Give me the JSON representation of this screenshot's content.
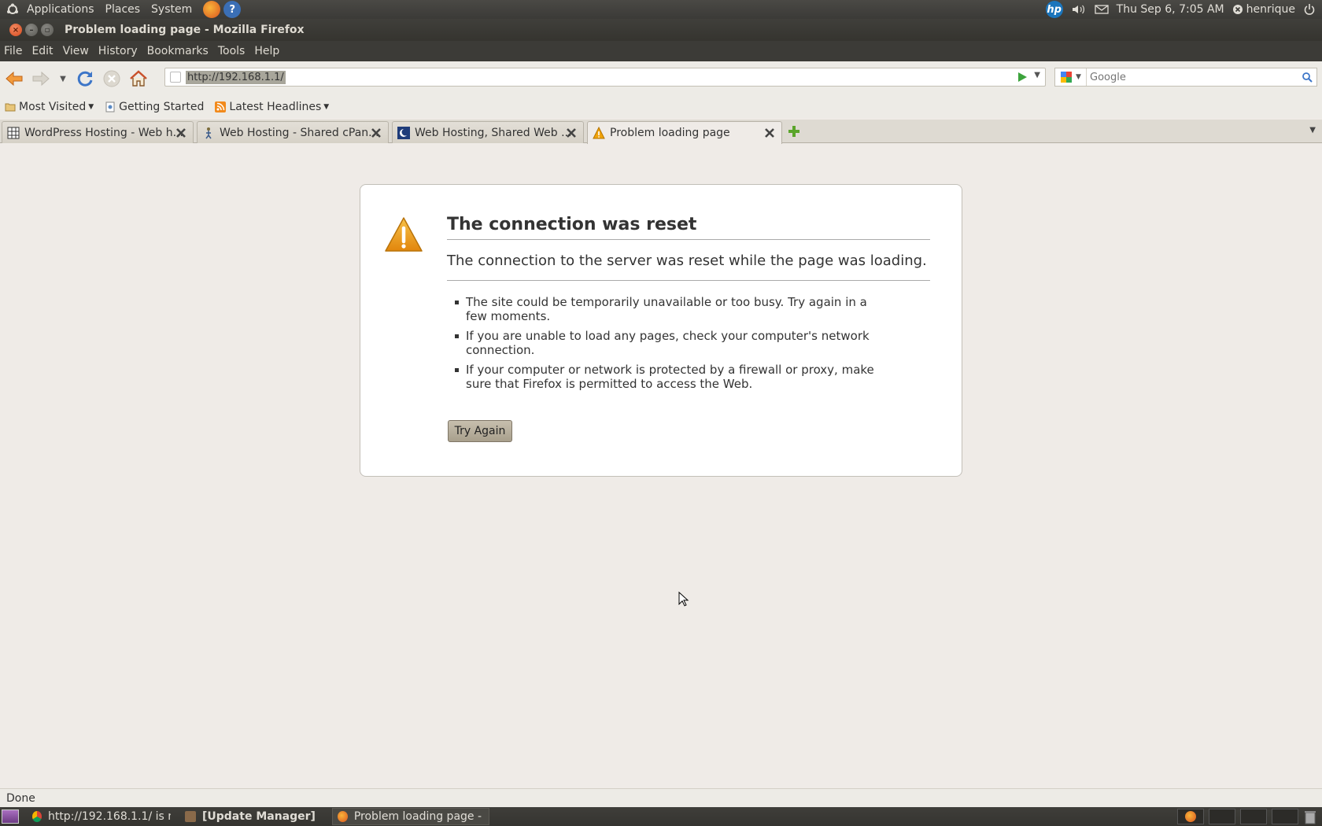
{
  "top_panel": {
    "menus": [
      "Applications",
      "Places",
      "System"
    ],
    "datetime": "Thu Sep  6,  7:05 AM",
    "user": "henrique",
    "hp_label": "hp"
  },
  "window": {
    "title": "Problem loading page - Mozilla Firefox"
  },
  "menubar": {
    "items": [
      "File",
      "Edit",
      "View",
      "History",
      "Bookmarks",
      "Tools",
      "Help"
    ]
  },
  "navbar": {
    "url": "http://192.168.1.1/",
    "search_placeholder": "Google"
  },
  "bookmarks": {
    "items": [
      "Most Visited",
      "Getting Started",
      "Latest Headlines"
    ]
  },
  "tabs": [
    {
      "label": "WordPress Hosting - Web h...",
      "active": false
    },
    {
      "label": "Web Hosting - Shared cPan...",
      "active": false
    },
    {
      "label": "Web Hosting, Shared Web ...",
      "active": false
    },
    {
      "label": "Problem loading page",
      "active": true
    }
  ],
  "error": {
    "title": "The connection was reset",
    "short_desc": "The connection to the server was reset while the page was loading.",
    "bullets": [
      "The site could be temporarily unavailable or too busy. Try again in a few moments.",
      "If you are unable to load any pages, check your computer's network connection.",
      "If your computer or network is protected by a firewall or proxy, make sure that Firefox is permitted to access the Web."
    ],
    "button": "Try Again"
  },
  "status": {
    "text": "Done"
  },
  "taskbar": {
    "items": [
      "http://192.168.1.1/ is no...",
      "[Update Manager]",
      "Problem loading page - ..."
    ]
  },
  "colors": {
    "panel": "#3c3b37",
    "warning": "#f0a30a",
    "content_bg": "#efebe7"
  }
}
